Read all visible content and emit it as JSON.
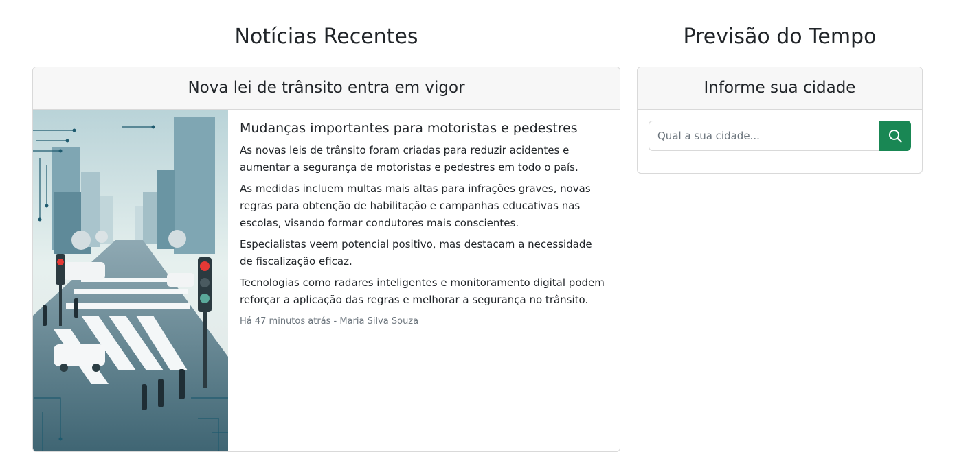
{
  "news": {
    "section_title": "Notícias Recentes",
    "card_header": "Nova lei de trânsito entra em vigor",
    "headline": "Mudanças importantes para motoristas e pedestres",
    "paragraphs": [
      "As novas leis de trânsito foram criadas para reduzir acidentes e aumentar a segurança de motoristas e pedestres em todo o país.",
      "As medidas incluem multas mais altas para infrações graves, novas regras para obtenção de habilitação e campanhas educativas nas escolas, visando formar condutores mais conscientes.",
      "Especialistas veem potencial positivo, mas destacam a necessidade de fiscalização eficaz.",
      "Tecnologias como radares inteligentes e monitoramento digital podem reforçar a aplicação das regras e melhorar a segurança no trânsito."
    ],
    "meta": "Há 47 minutos atrás - Maria Silva Souza",
    "image_icon": "city-crosswalk-traffic-illustration"
  },
  "weather": {
    "section_title": "Previsão do Tempo",
    "card_header": "Informe sua cidade",
    "input_placeholder": "Qual a sua cidade...",
    "input_value": "",
    "search_icon": "search-icon",
    "accent_color": "#198754"
  }
}
